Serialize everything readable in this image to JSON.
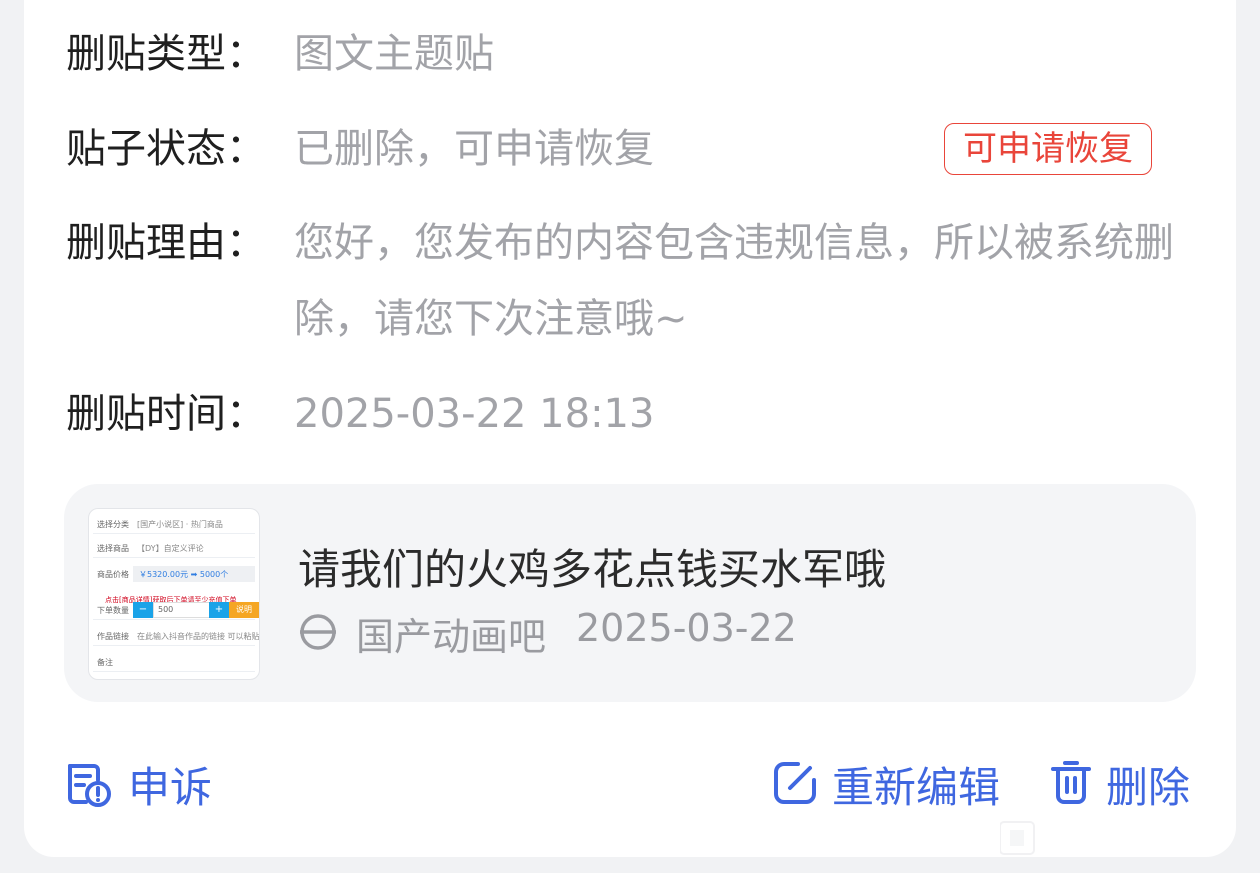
{
  "details": {
    "type": {
      "label": "删贴类型：",
      "value": "图文主题贴"
    },
    "status": {
      "label": "贴子状态：",
      "value": "已删除，可申请恢复",
      "badge": "可申请恢复"
    },
    "reason": {
      "label": "删贴理由：",
      "value": "您好，您发布的内容包含违规信息，所以被系统删除，请您下次注意哦~"
    },
    "time": {
      "label": "删贴时间：",
      "value": "2025-03-22 18:13"
    }
  },
  "post": {
    "title": "请我们的火鸡多花点钱买水军哦",
    "forum": "国产动画吧",
    "date": "2025-03-22",
    "thumbnail": {
      "rows": [
        {
          "label": "选择分类",
          "value": "[国产小说区] · 热门商品"
        },
        {
          "label": "选择商品",
          "value": "【DY】自定义评论"
        },
        {
          "label": "商品价格",
          "value": "￥5320.00元 ➡ 5000个"
        },
        {
          "label": "下单数量",
          "value": "500"
        },
        {
          "label": "作品链接",
          "value": "在此输入抖音作品的链接 可以粘贴哦"
        },
        {
          "label": "备注",
          "value": ""
        }
      ],
      "note": "点击[商品详情]获取后下单请至少充值下单",
      "minus": "−",
      "plus": "+",
      "confirm": "说明"
    }
  },
  "actions": {
    "appeal": "申诉",
    "edit": "重新编辑",
    "delete": "删除"
  },
  "colors": {
    "accent": "#3f67e0",
    "badge_red": "#e9453a",
    "label_text": "#1f1f1f",
    "value_text": "#a2a3a8"
  }
}
